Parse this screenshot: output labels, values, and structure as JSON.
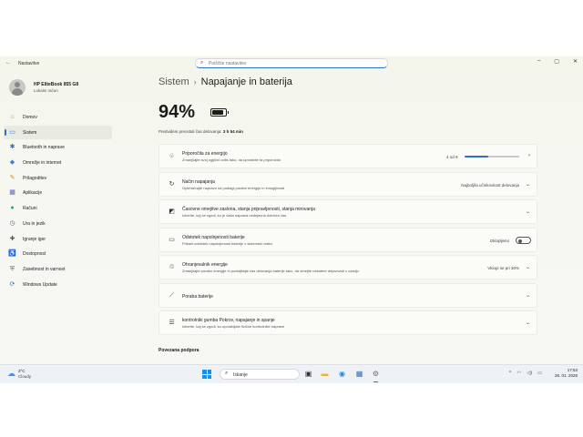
{
  "window": {
    "title": "Nastavitve",
    "controls": [
      "–",
      "▢",
      "✕"
    ]
  },
  "search": {
    "placeholder": "Poiščite nastavitev"
  },
  "profile": {
    "name": "HP EliteBook 855 G8",
    "account": "Lokalni račun"
  },
  "sidebar": {
    "items": [
      {
        "label": "Domov",
        "icon": "home-icon",
        "glyph": "⌂",
        "color": "#d9822b"
      },
      {
        "label": "Sistem",
        "icon": "monitor-icon",
        "glyph": "▭",
        "color": "#2f6fc6",
        "active": true
      },
      {
        "label": "Bluetooth in naprave",
        "icon": "bluetooth-icon",
        "glyph": "✱",
        "color": "#2f6fc6"
      },
      {
        "label": "Omrežje in internet",
        "icon": "network-icon",
        "glyph": "◆",
        "color": "#3b7ddd"
      },
      {
        "label": "Prilagoditev",
        "icon": "brush-icon",
        "glyph": "✎",
        "color": "#d9822b"
      },
      {
        "label": "Aplikacije",
        "icon": "apps-icon",
        "glyph": "▦",
        "color": "#5b5fc7"
      },
      {
        "label": "Računi",
        "icon": "account-icon",
        "glyph": "●",
        "color": "#2fa36b"
      },
      {
        "label": "Ura in jezik",
        "icon": "globe-clock-icon",
        "glyph": "◷",
        "color": "#2f6fc6"
      },
      {
        "label": "Igranje iger",
        "icon": "gamepad-icon",
        "glyph": "✚",
        "color": "#555555"
      },
      {
        "label": "Dostopnost",
        "icon": "accessibility-icon",
        "glyph": "♿",
        "color": "#2f6fc6"
      },
      {
        "label": "Zasebnost in varnost",
        "icon": "shield-icon",
        "glyph": "⛨",
        "color": "#6b6b6b"
      },
      {
        "label": "Windows Update",
        "icon": "update-icon",
        "glyph": "⟳",
        "color": "#2f6fc6"
      }
    ]
  },
  "breadcrumb": {
    "parent": "Sistem",
    "separator": "›",
    "current": "Napajanje in baterija"
  },
  "battery": {
    "percent": "94%",
    "level": 0.94,
    "estimate_label": "Predvideni preostali čas delovanja:",
    "estimate_value": "3 h 54 min"
  },
  "cards": [
    {
      "icon": "leaf-icon",
      "glyph": "♧",
      "title": "Priporočila za energijo",
      "desc": "Zmanjšajte svoj ogljični odtis tako, da uporabite ta priporočila",
      "right": "4 od 9",
      "progress": 0.44,
      "chevron": "›"
    },
    {
      "icon": "power-mode-icon",
      "glyph": "↻",
      "title": "Način napajanja",
      "desc": "Optimizirajte napravo na podlagi porabe energije in zmogljivosti",
      "right": "Najboljša učinkovitost delovanja",
      "chevron": "⌄"
    },
    {
      "icon": "screen-timeout-icon",
      "glyph": "◩",
      "title": "Časovne omejitve zaslona, stanja pripravljenosti, stanja mirovanja",
      "desc": "Izberite, kaj se zgodi, ko je vaša naprava nedejavna določen čas",
      "chevron": "⌄"
    },
    {
      "icon": "battery-percent-icon",
      "glyph": "▭",
      "title": "Odstotek napolnjenosti baterije",
      "desc": "Prikaži odstotek napolnjenosti baterije v sistemski vrstici",
      "right": "Izklopljeno",
      "toggle": false
    },
    {
      "icon": "energy-saver-icon",
      "glyph": "♲",
      "title": "Ohranjevalnik energije",
      "desc": "Zmanjšajte porabo energije in podaljšajte čas delovanja baterije tako, da omejite nekatere dejavnosti v ozadju",
      "right": "Vklopi se pri 30%",
      "chevron": "⌄"
    },
    {
      "icon": "battery-usage-icon",
      "glyph": "⟋",
      "title": "Poraba baterije",
      "chevron": "⌄"
    },
    {
      "icon": "lid-power-icon",
      "glyph": "☰",
      "title": "kontrolniki gumba Pokrov, napajanje in spanje",
      "desc": "Izberite, kaj se zgodi, ko uporabljate fizične kontrolnike naprave",
      "chevron": "⌄"
    }
  ],
  "related": {
    "title": "Povezana podpora"
  },
  "taskbar": {
    "weather": {
      "temp": "3°C",
      "desc": "Cloudy",
      "icon": "cloud-icon"
    },
    "search_label": "Iskanje",
    "apps": [
      {
        "name": "task-view-icon",
        "glyph": "▣",
        "color": "#333333"
      },
      {
        "name": "file-explorer-icon",
        "glyph": "▬",
        "color": "#e8b53a"
      },
      {
        "name": "edge-icon",
        "glyph": "◉",
        "color": "#1f8ad9"
      },
      {
        "name": "store-icon",
        "glyph": "▦",
        "color": "#2f6fc6"
      },
      {
        "name": "settings-icon",
        "glyph": "⚙",
        "color": "#6b6b6b",
        "active": true
      }
    ],
    "tray": {
      "chevron": "^",
      "wifi": "◠",
      "volume": "◁)",
      "battery": "▭"
    },
    "time": "17:53",
    "date": "26. 01. 2026"
  }
}
